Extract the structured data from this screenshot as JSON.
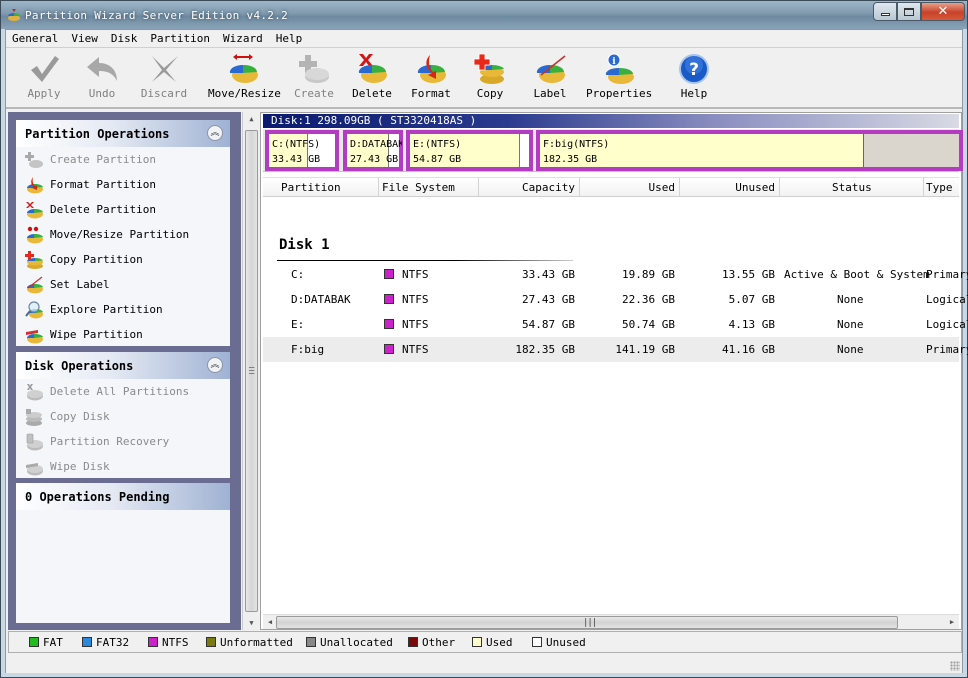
{
  "window": {
    "title": "Partition Wizard Server Edition v4.2.2",
    "controls": {
      "minimize": "minimize",
      "maximize": "maximize",
      "close": "close"
    }
  },
  "menu": [
    "General",
    "View",
    "Disk",
    "Partition",
    "Wizard",
    "Help"
  ],
  "toolbar": [
    {
      "label": "Apply",
      "icon": "checkmark-icon",
      "enabled": false
    },
    {
      "label": "Undo",
      "icon": "undo-arrow-icon",
      "enabled": false
    },
    {
      "label": "Discard",
      "icon": "discard-x-icon",
      "enabled": false
    },
    {
      "label": "Move/Resize",
      "icon": "move-resize-pie-icon",
      "enabled": true
    },
    {
      "label": "Create",
      "icon": "create-partition-icon",
      "enabled": false
    },
    {
      "label": "Delete",
      "icon": "delete-partition-icon",
      "enabled": true
    },
    {
      "label": "Format",
      "icon": "format-partition-icon",
      "enabled": true
    },
    {
      "label": "Copy",
      "icon": "copy-partition-icon",
      "enabled": true
    },
    {
      "label": "Label",
      "icon": "label-partition-icon",
      "enabled": true
    },
    {
      "label": "Properties",
      "icon": "properties-info-icon",
      "enabled": true
    },
    {
      "label": "Help",
      "icon": "help-question-icon",
      "enabled": true
    }
  ],
  "sidebar": {
    "partition_operations": {
      "title": "Partition Operations",
      "items": [
        {
          "label": "Create Partition",
          "enabled": false
        },
        {
          "label": "Format Partition",
          "enabled": true
        },
        {
          "label": "Delete Partition",
          "enabled": true
        },
        {
          "label": "Move/Resize Partition",
          "enabled": true
        },
        {
          "label": "Copy Partition",
          "enabled": true
        },
        {
          "label": "Set Label",
          "enabled": true
        },
        {
          "label": "Explore Partition",
          "enabled": true
        },
        {
          "label": "Wipe Partition",
          "enabled": true
        }
      ]
    },
    "disk_operations": {
      "title": "Disk Operations",
      "items": [
        {
          "label": "Delete All Partitions",
          "enabled": false
        },
        {
          "label": "Copy Disk",
          "enabled": false
        },
        {
          "label": "Partition Recovery",
          "enabled": false
        },
        {
          "label": "Wipe Disk",
          "enabled": false
        }
      ]
    },
    "pending": {
      "title": "0 Operations Pending"
    }
  },
  "diskmap": {
    "header": "Disk:1 298.09GB  ( ST3320418AS )",
    "partitions": [
      {
        "line1": "C:(NTFS)",
        "line2": "33.43 GB",
        "used_fraction": 0.595
      },
      {
        "line1": "D:DATABAK",
        "line2": "27.43 GB",
        "used_fraction": 0.815
      },
      {
        "line1": "E:(NTFS)",
        "line2": "54.87 GB",
        "used_fraction": 0.925
      },
      {
        "line1": "F:big(NTFS)",
        "line2": "182.35 GB",
        "used_fraction": 0.774,
        "selected": true
      }
    ]
  },
  "table": {
    "columns": [
      "Partition",
      "File System",
      "Capacity",
      "Used",
      "Unused",
      "Status",
      "Type"
    ],
    "disk_label": "Disk 1",
    "rows": [
      {
        "partition": "C:",
        "fs": "NTFS",
        "capacity": "33.43 GB",
        "used": "19.89 GB",
        "unused": "13.55 GB",
        "status": "Active & Boot & System",
        "type": "Primary"
      },
      {
        "partition": "D:DATABAK",
        "fs": "NTFS",
        "capacity": "27.43 GB",
        "used": "22.36 GB",
        "unused": "5.07 GB",
        "status": "None",
        "type": "Logical"
      },
      {
        "partition": "E:",
        "fs": "NTFS",
        "capacity": "54.87 GB",
        "used": "50.74 GB",
        "unused": "4.13 GB",
        "status": "None",
        "type": "Logical"
      },
      {
        "partition": "F:big",
        "fs": "NTFS",
        "capacity": "182.35 GB",
        "used": "141.19 GB",
        "unused": "41.16 GB",
        "status": "None",
        "type": "Primary",
        "selected": true
      }
    ]
  },
  "legend": [
    {
      "label": "FAT",
      "color": "#22bb22"
    },
    {
      "label": "FAT32",
      "color": "#2a88dd"
    },
    {
      "label": "NTFS",
      "color": "#cc22cc"
    },
    {
      "label": "Unformatted",
      "color": "#7a7a10"
    },
    {
      "label": "Unallocated",
      "color": "#888888"
    },
    {
      "label": "Other",
      "color": "#7a0a0a"
    },
    {
      "label": "Used",
      "color": "#ffffcc"
    },
    {
      "label": "Unused",
      "color": "#ffffff"
    }
  ],
  "colors": {
    "ntfs": "#cc22cc",
    "used": "#ffffcc",
    "panel_bg": "#6a6c92"
  }
}
